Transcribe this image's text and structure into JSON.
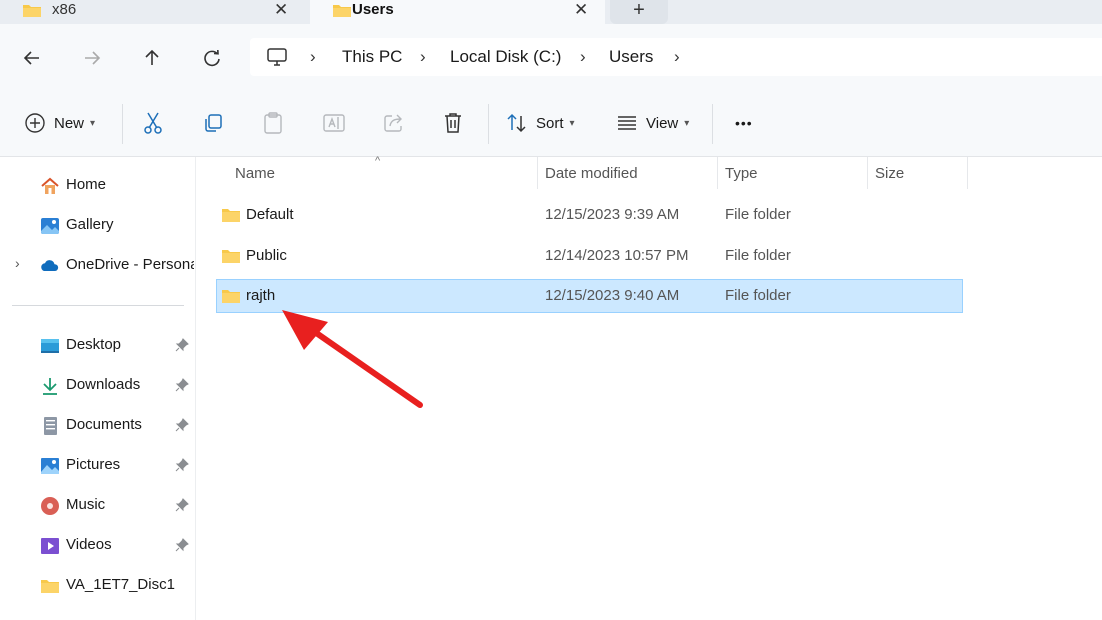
{
  "tabs": [
    {
      "title": "x86",
      "active": false
    },
    {
      "title": "Users",
      "active": true
    }
  ],
  "new_tab_symbol": "+",
  "breadcrumb": [
    "This PC",
    "Local Disk (C:)",
    "Users"
  ],
  "toolbar": {
    "new_label": "New",
    "sort_label": "Sort",
    "view_label": "View",
    "more_symbol": "•••"
  },
  "sidebar": {
    "top": [
      {
        "label": "Home",
        "icon": "home-icon"
      },
      {
        "label": "Gallery",
        "icon": "gallery-icon"
      },
      {
        "label": "OneDrive - Persona",
        "icon": "onedrive-icon",
        "expandable": true
      }
    ],
    "quick_access": [
      {
        "label": "Desktop",
        "icon": "desktop-icon",
        "pinned": true
      },
      {
        "label": "Downloads",
        "icon": "downloads-icon",
        "pinned": true
      },
      {
        "label": "Documents",
        "icon": "documents-icon",
        "pinned": true
      },
      {
        "label": "Pictures",
        "icon": "pictures-icon",
        "pinned": true
      },
      {
        "label": "Music",
        "icon": "music-icon",
        "pinned": true
      },
      {
        "label": "Videos",
        "icon": "videos-icon",
        "pinned": true
      },
      {
        "label": "VA_1ET7_Disc1",
        "icon": "folder-icon",
        "pinned": false
      }
    ]
  },
  "columns": {
    "name": "Name",
    "date": "Date modified",
    "type": "Type",
    "size": "Size"
  },
  "files": [
    {
      "name": "Default",
      "date": "12/15/2023 9:39 AM",
      "type": "File folder",
      "selected": false
    },
    {
      "name": "Public",
      "date": "12/14/2023 10:57 PM",
      "type": "File folder",
      "selected": false
    },
    {
      "name": "rajth",
      "date": "12/15/2023 9:40 AM",
      "type": "File folder",
      "selected": true
    }
  ],
  "colors": {
    "selection_bg": "#cce8ff",
    "selection_border": "#99d1ff",
    "folder_yellow": "#f8c94a",
    "annotation_red": "#e8201f"
  }
}
